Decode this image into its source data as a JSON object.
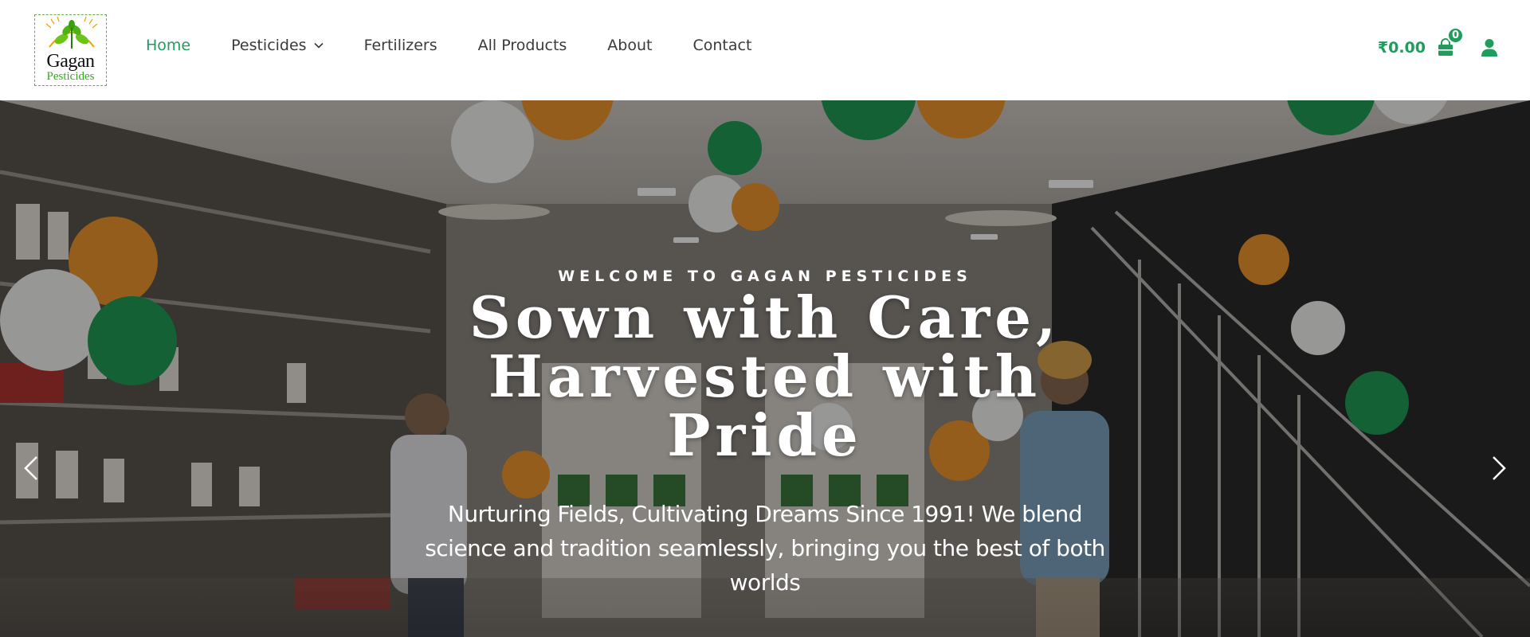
{
  "brand": {
    "logo_top": "Gagan",
    "logo_bottom": "Pesticides"
  },
  "nav": {
    "items": [
      {
        "label": "Home",
        "active": true
      },
      {
        "label": "Pesticides",
        "has_dropdown": true
      },
      {
        "label": "Fertilizers"
      },
      {
        "label": "All Products"
      },
      {
        "label": "About"
      },
      {
        "label": "Contact"
      }
    ]
  },
  "header_right": {
    "cart_total": "₹0.00",
    "cart_count": "0",
    "cart_icon": "shopping-bag-icon",
    "account_icon": "user-icon"
  },
  "hero": {
    "eyebrow": "WELCOME TO GAGAN PESTICIDES",
    "headline_line1": "Sown with Care,",
    "headline_line2": "Harvested with",
    "headline_line3": "Pride",
    "subtext": "Nurturing Fields, Cultivating Dreams Since 1991! We blend science and tradition seamlessly, bringing you the best of both worlds",
    "prev_icon": "chevron-left-icon",
    "next_icon": "chevron-right-icon"
  },
  "colors": {
    "accent": "#1f9d5c",
    "nav_text": "#3a3a3a",
    "logo_green": "#34a91c"
  }
}
